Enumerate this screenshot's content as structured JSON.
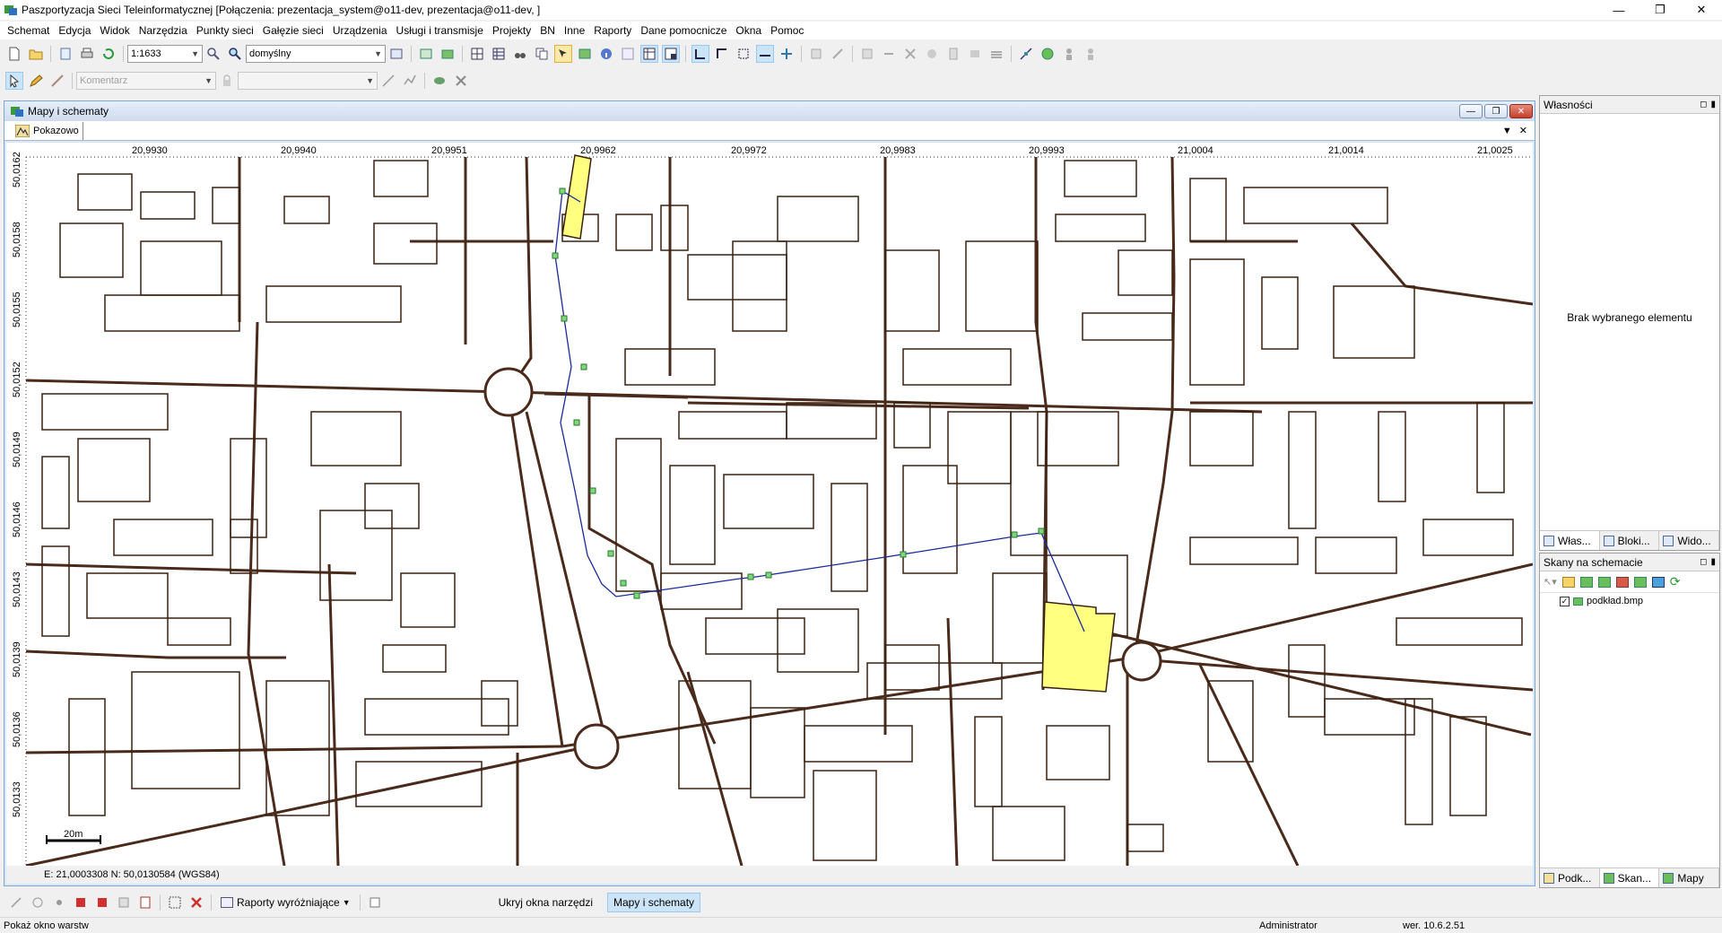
{
  "window": {
    "title": "Paszportyzacja Sieci Teleinformatycznej [Połączenia: prezentacja_system@o11-dev, prezentacja@o11-dev, ]",
    "controls": {
      "minimize": "—",
      "restore": "❐",
      "close": "✕"
    }
  },
  "menu": [
    "Schemat",
    "Edycja",
    "Widok",
    "Narzędzia",
    "Punkty sieci",
    "Gałęzie sieci",
    "Urządzenia",
    "Usługi i transmisje",
    "Projekty",
    "BN",
    "Inne",
    "Raporty",
    "Dane pomocnicze",
    "Okna",
    "Pomoc"
  ],
  "toolbar": {
    "scale_value": "1:1633",
    "layer_style_value": "domyślny",
    "comment_placeholder": "Komentarz"
  },
  "map_window": {
    "title": "Mapy i schematy",
    "tab_label": "Pokazowo",
    "x_ticks": [
      "20,9930",
      "20,9940",
      "20,9951",
      "20,9962",
      "20,9972",
      "20,9983",
      "20,9993",
      "21,0004",
      "21,0014",
      "21,0025"
    ],
    "y_ticks": [
      "50,0162",
      "50,0158",
      "50,0155",
      "50,0152",
      "50,0149",
      "50,0146",
      "50,0143",
      "50,0139",
      "50,0136",
      "50,0133"
    ],
    "scale_bar_label": "20m",
    "coords": "E: 21,0003308  N: 50,0130584 (WGS84)"
  },
  "properties_panel": {
    "title": "Własności",
    "empty_text": "Brak wybranego elementu",
    "tabs": [
      "Włas...",
      "Bloki...",
      "Wido..."
    ]
  },
  "scans_panel": {
    "title": "Skany na schemacie",
    "items": [
      {
        "label": "podkład.bmp",
        "checked": true
      }
    ],
    "tabs": [
      "Podk...",
      "Skan...",
      "Mapy"
    ]
  },
  "bottom_bar": {
    "reports_label": "Raporty wyróżniające",
    "hide_tools_label": "Ukryj okna narzędzi",
    "maps_button_label": "Mapy i schematy"
  },
  "status_bar": {
    "left": "Pokaż okno warstw",
    "user": "Administrator",
    "version": "wer. 10.6.2.51"
  },
  "colors": {
    "road": "#4a2a1a",
    "building_highlight": "#ffff80",
    "route": "#1a2a9a",
    "node": "#4caf50",
    "window_border": "#7fa7d4"
  }
}
